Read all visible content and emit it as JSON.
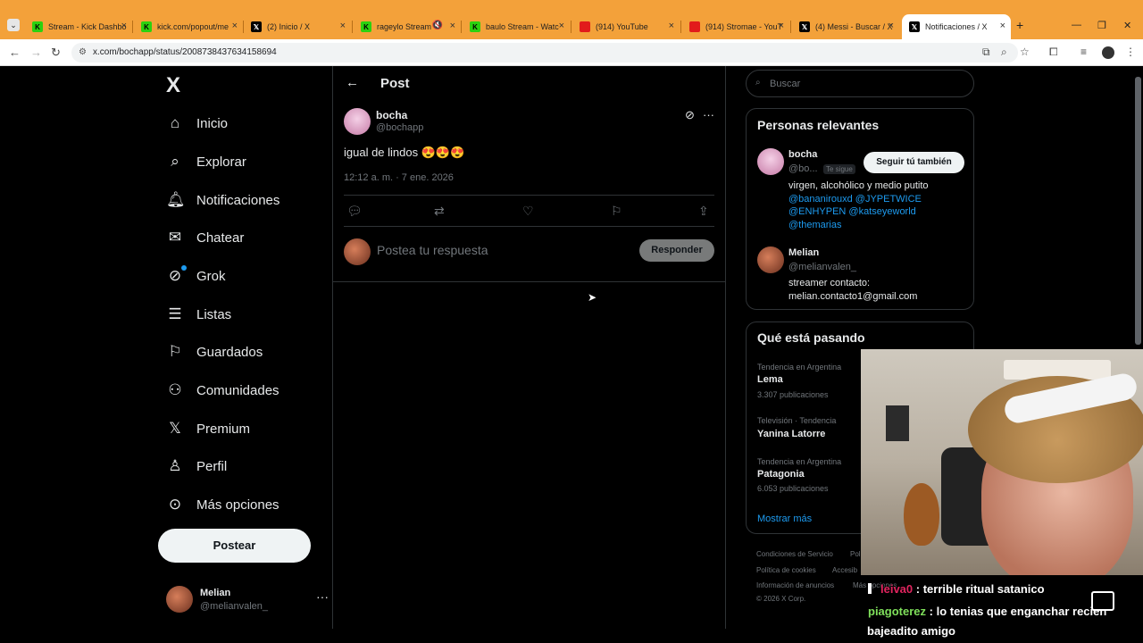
{
  "browser": {
    "tabs": [
      {
        "label": "Stream - Kick Dashbo",
        "icon": "kick-icon"
      },
      {
        "label": "kick.com/popout/me",
        "icon": "kick-icon"
      },
      {
        "label": "(2) Inicio / X",
        "icon": "x-icon"
      },
      {
        "label": "rageylo Stream -",
        "icon": "kick-icon"
      },
      {
        "label": "baulo Stream - Watc",
        "icon": "kick-icon"
      },
      {
        "label": "(914) YouTube",
        "icon": "youtube-icon"
      },
      {
        "label": "(914) Stromae - YouT",
        "icon": "youtube-icon"
      },
      {
        "label": "(4) Messi - Buscar / X",
        "icon": "x-icon"
      },
      {
        "label": "Notificaciones / X",
        "icon": "x-icon",
        "active": true
      }
    ],
    "url": "x.com/bochapp/status/2008738437634158694"
  },
  "nav": {
    "logo": "X",
    "items": [
      {
        "label": "Inicio",
        "icon": "home-icon"
      },
      {
        "label": "Explorar",
        "icon": "search-icon"
      },
      {
        "label": "Notificaciones",
        "icon": "bell-icon"
      },
      {
        "label": "Chatear",
        "icon": "mail-icon"
      },
      {
        "label": "Grok",
        "icon": "grok-icon"
      },
      {
        "label": "Listas",
        "icon": "list-icon"
      },
      {
        "label": "Guardados",
        "icon": "bookmark-icon"
      },
      {
        "label": "Comunidades",
        "icon": "people-icon"
      },
      {
        "label": "Premium",
        "icon": "x-icon"
      },
      {
        "label": "Perfil",
        "icon": "person-icon"
      },
      {
        "label": "Más opciones",
        "icon": "more-circle-icon"
      }
    ],
    "post_button": "Postear",
    "account": {
      "name": "Melian",
      "handle": "@melianvalen_"
    }
  },
  "post": {
    "header": "Post",
    "author_name": "bocha",
    "author_handle": "@bochapp",
    "text": "igual de lindos 😍😍😍",
    "timestamp": "12:12 a. m. · 7 ene. 2026",
    "reply_placeholder": "Postea tu respuesta",
    "reply_button": "Responder"
  },
  "sidebar": {
    "search_placeholder": "Buscar",
    "relevant": {
      "title": "Personas relevantes",
      "people": [
        {
          "name": "bocha",
          "handle": "@bo...",
          "badge": "Te sigue",
          "follow_label": "Seguir tú también",
          "bio_text": "virgen, alcohólico y medio putito",
          "bio_links": [
            "@bananirouxd",
            "@JYPETWICE",
            "@ENHYPEN",
            "@katseyeworld",
            "@themarias"
          ]
        },
        {
          "name": "Melian",
          "handle": "@melianvalen_",
          "bio_line1": "streamer contacto:",
          "bio_line2": "melian.contacto1@gmail.com"
        }
      ]
    },
    "trends": {
      "title": "Qué está pasando",
      "items": [
        {
          "meta": "Tendencia en Argentina",
          "name": "Lema",
          "count": "3.307 publicaciones"
        },
        {
          "meta": "Televisión · Tendencia",
          "name": "Yanina Latorre",
          "count": ""
        },
        {
          "meta": "Tendencia en Argentina",
          "name": "Patagonia",
          "count": "6.053 publicaciones"
        }
      ],
      "show_more": "Mostrar más"
    },
    "footer": {
      "links": [
        "Condiciones de Servicio",
        "Pol",
        "Política de cookies",
        "Accesib",
        "Información de anuncios",
        "Más opciones"
      ],
      "copyright": "© 2026 X Corp."
    }
  },
  "chat": {
    "messages": [
      {
        "user": "leiva0",
        "user_color": "#e0245e",
        "text": ": terrible ritual satanico"
      },
      {
        "user": "piagoterez",
        "user_color": "#7fe05b",
        "text": ": lo tenias que enganchar recien"
      },
      {
        "user": "",
        "user_color": "#ffffff",
        "text": "bajeadito amigo"
      }
    ]
  },
  "colors": {
    "browser_frame": "#f3a13a",
    "link": "#1d9bf0",
    "background": "#000000"
  }
}
